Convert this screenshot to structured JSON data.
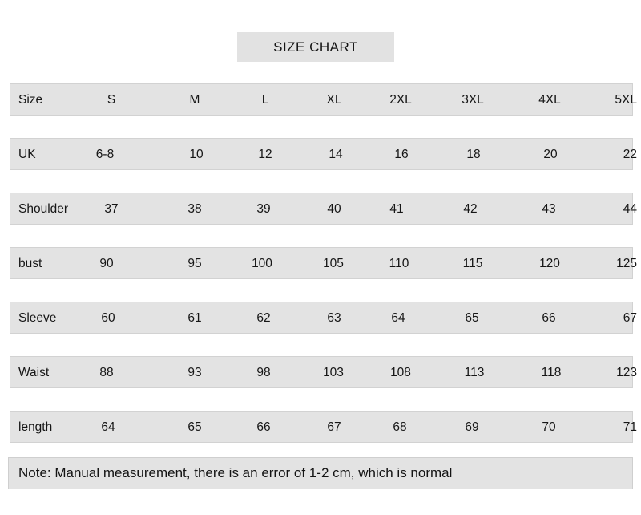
{
  "title": "SIZE CHART",
  "note": "Note: Manual measurement, there is an error of 1-2 cm, which is normal",
  "colors": {
    "band": "#e3e3e3",
    "page_background": "#ffffff",
    "text": "#161616"
  },
  "chart_data": {
    "type": "table",
    "title": "SIZE CHART",
    "columns": [
      "Size",
      "S",
      "M",
      "L",
      "XL",
      "2XL",
      "3XL",
      "4XL",
      "5XL"
    ],
    "rows": [
      {
        "label": "UK",
        "values": [
          "6-8",
          "10",
          "12",
          "14",
          "16",
          "18",
          "20",
          "22"
        ]
      },
      {
        "label": "Shoulder",
        "values": [
          "37",
          "38",
          "39",
          "40",
          "41",
          "42",
          "43",
          "44"
        ]
      },
      {
        "label": "bust",
        "values": [
          "90",
          "95",
          "100",
          "105",
          "110",
          "115",
          "120",
          "125"
        ]
      },
      {
        "label": "Sleeve",
        "values": [
          "60",
          "61",
          "62",
          "63",
          "64",
          "65",
          "66",
          "67"
        ]
      },
      {
        "label": "Waist",
        "values": [
          "88",
          "93",
          "98",
          "103",
          "108",
          "113",
          "118",
          "123"
        ]
      },
      {
        "label": "length",
        "values": [
          "64",
          "65",
          "66",
          "67",
          "68",
          "69",
          "70",
          "71"
        ]
      }
    ],
    "note": "Note: Manual measurement, there is an error of 1-2 cm, which is normal"
  }
}
